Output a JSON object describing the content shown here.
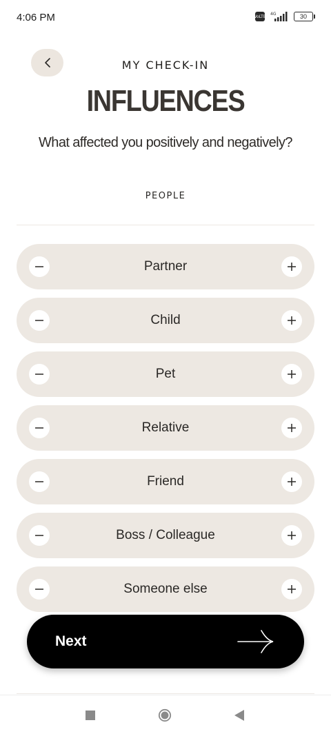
{
  "status": {
    "time": "4:06 PM",
    "battery": "30",
    "network": "4G",
    "volte": "Vo LTE"
  },
  "header": {
    "back_icon": "chevron-left-icon",
    "section_label": "MY CHECK-IN",
    "title": "INFLUENCES",
    "subtitle": "What affected you positively and negatively?"
  },
  "category": {
    "label": "PEOPLE"
  },
  "items": [
    {
      "label": "Partner"
    },
    {
      "label": "Child"
    },
    {
      "label": "Pet"
    },
    {
      "label": "Relative"
    },
    {
      "label": "Friend"
    },
    {
      "label": "Boss / Colleague"
    },
    {
      "label": "Someone else"
    }
  ],
  "next_button": {
    "label": "Next",
    "icon": "arrow-right-icon"
  },
  "colors": {
    "row_bg": "#ede8e2",
    "next_bg": "#000000",
    "title": "#3a3632"
  }
}
